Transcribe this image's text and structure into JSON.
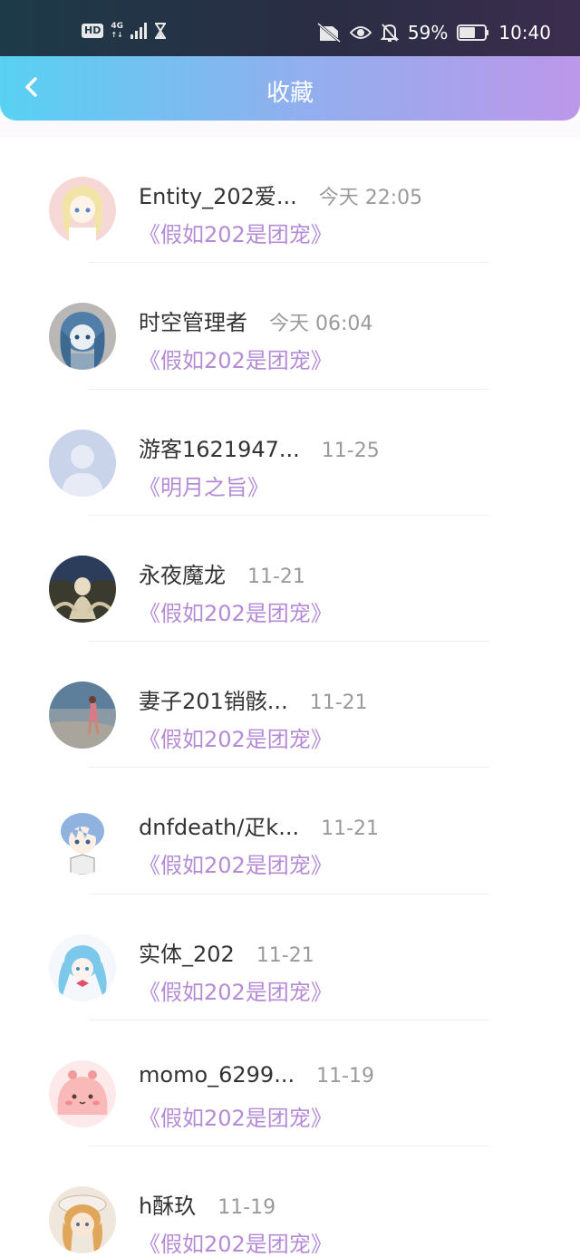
{
  "status_bar": {
    "left_icons": [
      "hd-icon",
      "network-4g-icon",
      "signal-icon",
      "hourglass-icon"
    ],
    "network_label": "4G",
    "battery_percent": "59%",
    "time": "10:40",
    "right_icons": [
      "no-sim-icon",
      "eye-icon",
      "bell-mute-icon",
      "battery-icon"
    ]
  },
  "header": {
    "title": "收藏",
    "back_icon": "chevron-left-icon"
  },
  "colors": {
    "accent_start": "#58d1f2",
    "accent_end": "#bc97ea",
    "work_title": "#b58bd6",
    "name_text": "#333333",
    "time_text": "#9a9a9a"
  },
  "favorites": [
    {
      "name": "Entity_202爱...",
      "time": "今天 22:05",
      "work": "《假如202是团宠》",
      "avatar": "anime-blonde-girl-avatar"
    },
    {
      "name": "时空管理者",
      "time": "今天 06:04",
      "work": "《假如202是团宠》",
      "avatar": "anime-blue-hair-avatar"
    },
    {
      "name": "游客1621947...",
      "time": "11-25",
      "work": "《明月之旨》",
      "avatar": "default-user-avatar"
    },
    {
      "name": "永夜魔龙",
      "time": "11-21",
      "work": "《假如202是团宠》",
      "avatar": "anime-dark-scene-avatar"
    },
    {
      "name": "妻子201销骸...",
      "time": "11-21",
      "work": "《假如202是团宠》",
      "avatar": "beach-photo-avatar"
    },
    {
      "name": "dnfdeath/疋k...",
      "time": "11-21",
      "work": "《假如202是团宠》",
      "avatar": "anime-boy-blue-hair-avatar"
    },
    {
      "name": "实体_202",
      "time": "11-21",
      "work": "《假如202是团宠》",
      "avatar": "anime-miku-avatar"
    },
    {
      "name": "momo_6299...",
      "time": "11-19",
      "work": "《假如202是团宠》",
      "avatar": "pink-blob-avatar"
    },
    {
      "name": "h酥玖",
      "time": "11-19",
      "work": "《假如202是团宠》",
      "avatar": "anime-girl-hat-avatar"
    }
  ]
}
